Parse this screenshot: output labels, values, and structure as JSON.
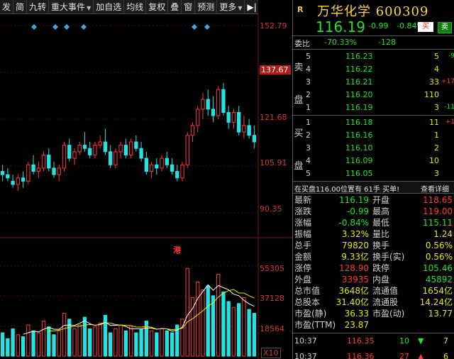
{
  "toolbar": {
    "items": [
      "发",
      "简",
      "九转",
      "重大事件",
      "加自选",
      "均线",
      "复权",
      "叠",
      "窗",
      "预测",
      "更多"
    ],
    "arrow_label": "▶"
  },
  "stock": {
    "market_tag": "R",
    "name_code": "万华化学 600309",
    "price": "116.19",
    "change": "-0.99",
    "change_pct": "-0.84%",
    "flag": "融",
    "buy_label": "买",
    "sell_label": "卖"
  },
  "webi": {
    "label": "委比",
    "ratio": "-70.33%",
    "diff": "-128"
  },
  "sell_side_label": [
    "卖",
    "盘"
  ],
  "buy_side_label": [
    "买",
    "盘"
  ],
  "sell_orders": [
    {
      "level": "5",
      "price": "116.23",
      "qty": "5",
      "delta": "-9"
    },
    {
      "level": "4",
      "price": "116.22",
      "qty": "4",
      "delta": ""
    },
    {
      "level": "3",
      "price": "116.21",
      "qty": "33",
      "delta": "+17"
    },
    {
      "level": "2",
      "price": "116.20",
      "qty": "110",
      "delta": ""
    },
    {
      "level": "1",
      "price": "116.19",
      "qty": "3",
      "delta": "-11"
    }
  ],
  "buy_orders": [
    {
      "level": "1",
      "price": "116.18",
      "qty": "11",
      "delta": "+1"
    },
    {
      "level": "2",
      "price": "116.16",
      "qty": "1",
      "delta": ""
    },
    {
      "level": "3",
      "price": "116.10",
      "qty": "2",
      "delta": ""
    },
    {
      "level": "4",
      "price": "116.09",
      "qty": "10",
      "delta": ""
    },
    {
      "level": "5",
      "price": "116.05",
      "qty": "3",
      "delta": ""
    }
  ],
  "hint": {
    "text": "在买盘116.00位置有 61手 买单!",
    "detail": "查看详细"
  },
  "stats": [
    [
      "最新",
      "116.19",
      "开盘",
      "118.65"
    ],
    [
      "涨跌",
      "-0.99",
      "最高",
      "119.00"
    ],
    [
      "涨幅",
      "-0.84%",
      "最低",
      "115.11"
    ],
    [
      "振幅",
      "3.32%",
      "量比",
      "1.24"
    ],
    [
      "总手",
      "79820",
      "换手",
      "0.56%"
    ],
    [
      "金额",
      "9.33亿",
      "换手(实)",
      "0.56%"
    ],
    [
      "涨停",
      "128.90",
      "跌停",
      "105.46"
    ],
    [
      "外盘",
      "33935",
      "内盘",
      "45892"
    ],
    [
      "总市值",
      "3648亿",
      "流通值",
      "1654亿"
    ],
    [
      "总股本",
      "31.40亿",
      "流通股",
      "14.24亿"
    ],
    [
      "市盈(静)",
      "36.33",
      "市盈(动)",
      "13.77"
    ],
    [
      "市盈(TTM)",
      "23.87",
      "",
      ""
    ]
  ],
  "ticks": [
    {
      "time": "10:37",
      "price": "116.35",
      "vol": "10",
      "dir": "down",
      "n": "7"
    },
    {
      "time": "10:37",
      "price": "116.36",
      "vol": "27",
      "dir": "up",
      "n": "6"
    }
  ],
  "chart_labels": {
    "price_axis": [
      "152.79",
      "137.67",
      "121.68",
      "105.91",
      "90.35"
    ],
    "volume_axis": [
      "55305",
      "37128",
      "18564"
    ],
    "port_marker": "港",
    "multiplier": "X10"
  },
  "colors": {
    "up": "#ff3a3a",
    "down": "#25e2e2",
    "ma5": "#ffffff",
    "ma10": "#e8e800",
    "ma20": "#c040c0"
  },
  "chart_data": {
    "type": "candlestick",
    "series_note": "daily K-line, open/high/low/close",
    "ylim": [
      90,
      155
    ],
    "candles": [
      [
        107,
        109,
        104,
        106
      ],
      [
        106,
        108,
        104,
        105
      ],
      [
        104,
        106,
        102,
        103
      ],
      [
        103,
        106,
        101,
        105
      ],
      [
        105,
        107,
        102,
        104
      ],
      [
        104,
        110,
        103,
        109
      ],
      [
        109,
        112,
        106,
        107
      ],
      [
        107,
        110,
        105,
        108
      ],
      [
        108,
        113,
        107,
        112
      ],
      [
        112,
        114,
        107,
        108
      ],
      [
        108,
        110,
        105,
        106
      ],
      [
        106,
        109,
        104,
        108
      ],
      [
        108,
        116,
        107,
        115
      ],
      [
        115,
        117,
        110,
        111
      ],
      [
        111,
        114,
        109,
        113
      ],
      [
        113,
        116,
        112,
        115
      ],
      [
        115,
        119,
        113,
        114
      ],
      [
        114,
        116,
        111,
        112
      ],
      [
        112,
        116,
        111,
        115
      ],
      [
        115,
        118,
        114,
        116
      ],
      [
        116,
        120,
        112,
        113
      ],
      [
        113,
        115,
        108,
        109
      ],
      [
        109,
        114,
        108,
        113
      ],
      [
        113,
        116,
        111,
        115
      ],
      [
        115,
        117,
        111,
        112
      ],
      [
        112,
        117,
        111,
        116
      ],
      [
        116,
        118,
        113,
        114
      ],
      [
        114,
        116,
        110,
        111
      ],
      [
        111,
        113,
        106,
        107
      ],
      [
        107,
        110,
        105,
        109
      ],
      [
        109,
        111,
        106,
        108
      ],
      [
        108,
        112,
        107,
        111
      ],
      [
        111,
        113,
        108,
        109
      ],
      [
        109,
        111,
        106,
        107
      ],
      [
        107,
        109,
        104,
        105
      ],
      [
        105,
        110,
        104,
        109
      ],
      [
        109,
        119,
        108,
        118
      ],
      [
        118,
        122,
        116,
        121
      ],
      [
        121,
        127,
        119,
        126
      ],
      [
        126,
        131,
        123,
        129
      ],
      [
        129,
        132,
        124,
        126
      ],
      [
        126,
        130,
        122,
        124
      ],
      [
        124,
        133,
        123,
        132
      ],
      [
        132,
        134,
        124,
        125
      ],
      [
        125,
        127,
        120,
        122
      ],
      [
        122,
        126,
        120,
        125
      ],
      [
        125,
        127,
        118,
        119
      ],
      [
        119,
        124,
        117,
        121
      ],
      [
        121,
        123,
        117,
        118
      ],
      [
        118,
        121,
        114,
        116
      ]
    ],
    "volumes": [
      12,
      9,
      14,
      11,
      10,
      16,
      13,
      12,
      18,
      15,
      11,
      13,
      22,
      19,
      14,
      16,
      20,
      14,
      15,
      17,
      21,
      12,
      14,
      16,
      13,
      15,
      12,
      14,
      18,
      13,
      12,
      14,
      13,
      12,
      16,
      19,
      45,
      30,
      38,
      34,
      36,
      31,
      42,
      33,
      28,
      25,
      27,
      30,
      24,
      22
    ],
    "volume_ylim": [
      0,
      55305
    ]
  }
}
